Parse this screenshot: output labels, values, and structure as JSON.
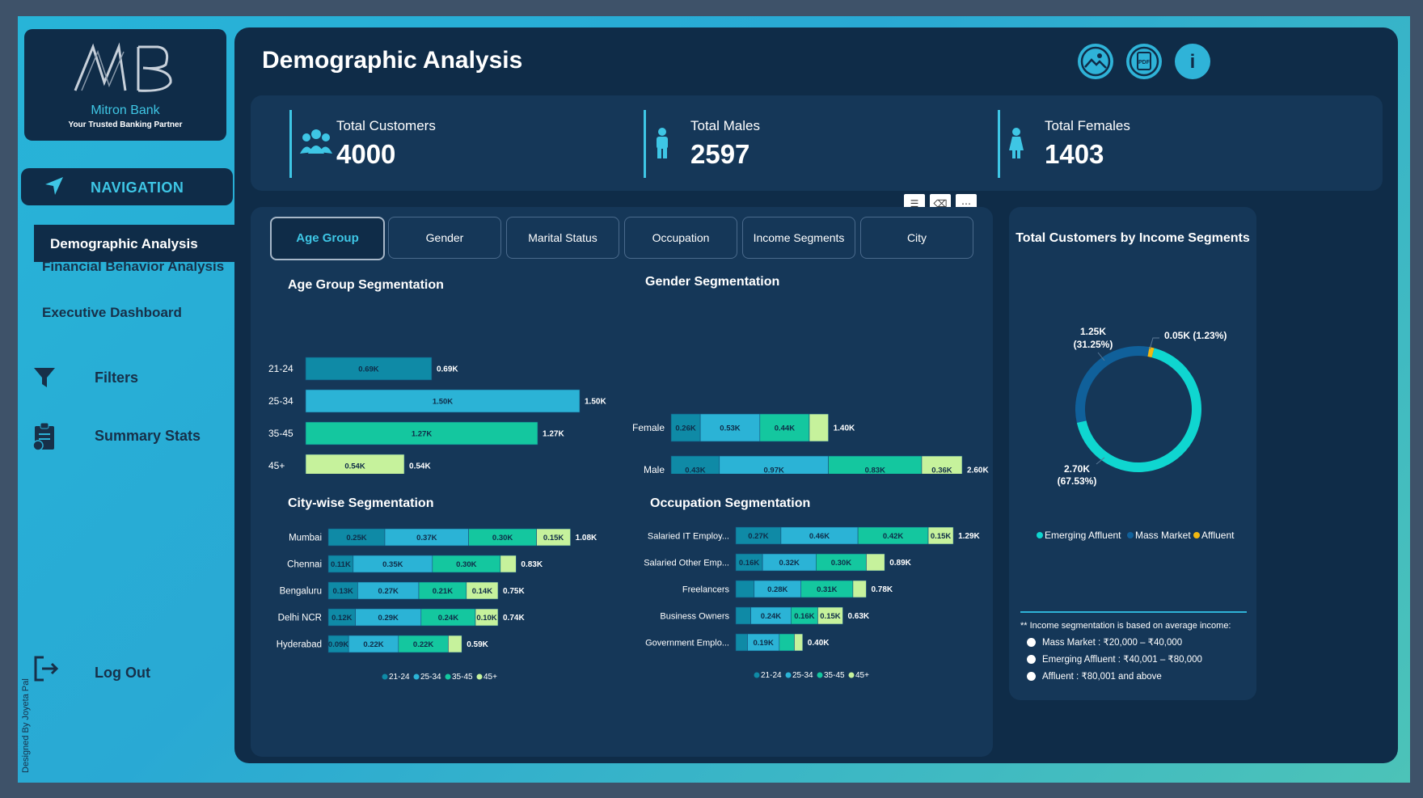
{
  "sidebar": {
    "bank_name": "Mitron Bank",
    "tagline": "Your Trusted Banking Partner",
    "nav_header": "NAVIGATION",
    "nav_items": [
      {
        "label": "Demographic Analysis",
        "active": true
      },
      {
        "label": "Financial Behavior Analysis"
      },
      {
        "label": "Executive Dashboard"
      }
    ],
    "filters_label": "Filters",
    "summary_label": "Summary Stats",
    "logout_label": "Log Out",
    "designed_by": "Designed By Joyeta Pal"
  },
  "header": {
    "title": "Demographic Analysis",
    "buttons": [
      {
        "icon": "image-icon"
      },
      {
        "icon": "pdf-icon",
        "text": "PDF"
      },
      {
        "icon": "info-icon",
        "text": "i"
      }
    ]
  },
  "kpis": [
    {
      "label": "Total Customers",
      "value": "4000",
      "icon": "people-icon"
    },
    {
      "label": "Total Males",
      "value": "2597",
      "icon": "male-icon"
    },
    {
      "label": "Total Females",
      "value": "1403",
      "icon": "female-icon"
    }
  ],
  "tabs": [
    "Age Group",
    "Gender",
    "Marital Status",
    "Occupation",
    "Income Segments",
    "City"
  ],
  "active_tab": "Age Group",
  "legend_labels": [
    "21-24",
    "25-34",
    "35-45",
    "45+"
  ],
  "colors": {
    "series": [
      "#0f8aa6",
      "#2bb3d6",
      "#14c79f",
      "#c6f29c"
    ],
    "income": {
      "Emerging Affluent": "#0fd6d0",
      "Mass Market": "#10609a",
      "Affluent": "#f1b811"
    },
    "accent": "#3ec6e5"
  },
  "chart_data": [
    {
      "type": "bar",
      "title": "Age Group Segmentation",
      "orientation": "horizontal",
      "categories": [
        "21-24",
        "25-34",
        "35-45",
        "45+"
      ],
      "values": [
        0.69,
        1.5,
        1.27,
        0.54
      ],
      "labels": [
        "0.69K",
        "1.50K",
        "1.27K",
        "0.54K"
      ],
      "totals": [
        "0.69K",
        "1.50K",
        "1.27K",
        "0.54K"
      ]
    },
    {
      "type": "bar",
      "title": "Gender Segmentation",
      "orientation": "horizontal",
      "stacked": true,
      "categories": [
        "Female",
        "Male"
      ],
      "series": [
        {
          "name": "21-24",
          "values": [
            0.26,
            0.43
          ],
          "labels": [
            "0.26K",
            "0.43K"
          ]
        },
        {
          "name": "25-34",
          "values": [
            0.53,
            0.97
          ],
          "labels": [
            "0.53K",
            "0.97K"
          ]
        },
        {
          "name": "35-45",
          "values": [
            0.44,
            0.83
          ],
          "labels": [
            "0.44K",
            "0.83K"
          ]
        },
        {
          "name": "45+",
          "values": [
            0.17,
            0.36
          ],
          "labels": [
            "",
            "0.36K"
          ]
        }
      ],
      "totals": [
        "1.40K",
        "2.60K"
      ]
    },
    {
      "type": "bar",
      "title": "City-wise Segmentation",
      "orientation": "horizontal",
      "stacked": true,
      "categories": [
        "Mumbai",
        "Chennai",
        "Bengaluru",
        "Delhi NCR",
        "Hyderabad"
      ],
      "series": [
        {
          "name": "21-24",
          "values": [
            0.25,
            0.11,
            0.13,
            0.12,
            0.09
          ],
          "labels": [
            "0.25K",
            "0.11K",
            "0.13K",
            "0.12K",
            "0.09K"
          ]
        },
        {
          "name": "25-34",
          "values": [
            0.37,
            0.35,
            0.27,
            0.29,
            0.22
          ],
          "labels": [
            "0.37K",
            "0.35K",
            "0.27K",
            "0.29K",
            "0.22K"
          ]
        },
        {
          "name": "35-45",
          "values": [
            0.3,
            0.3,
            0.21,
            0.24,
            0.22
          ],
          "labels": [
            "0.30K",
            "0.30K",
            "0.21K",
            "0.24K",
            "0.22K"
          ]
        },
        {
          "name": "45+",
          "values": [
            0.15,
            0.07,
            0.14,
            0.1,
            0.06
          ],
          "labels": [
            "0.15K",
            "",
            "0.14K",
            "0.10K",
            ""
          ]
        }
      ],
      "totals": [
        "1.08K",
        "0.83K",
        "0.75K",
        "0.74K",
        "0.59K"
      ]
    },
    {
      "type": "bar",
      "title": "Occupation Segmentation",
      "orientation": "horizontal",
      "stacked": true,
      "categories": [
        "Salaried IT Employ...",
        "Salaried Other Emp...",
        "Freelancers",
        "Business Owners",
        "Government Emplo..."
      ],
      "series": [
        {
          "name": "21-24",
          "values": [
            0.27,
            0.16,
            0.11,
            0.09,
            0.07
          ],
          "labels": [
            "0.27K",
            "0.16K",
            "",
            "",
            ""
          ]
        },
        {
          "name": "25-34",
          "values": [
            0.46,
            0.32,
            0.28,
            0.24,
            0.19
          ],
          "labels": [
            "0.46K",
            "0.32K",
            "0.28K",
            "0.24K",
            "0.19K"
          ]
        },
        {
          "name": "35-45",
          "values": [
            0.42,
            0.3,
            0.31,
            0.16,
            0.09
          ],
          "labels": [
            "0.42K",
            "0.30K",
            "0.31K",
            "0.16K",
            ""
          ]
        },
        {
          "name": "45+",
          "values": [
            0.15,
            0.11,
            0.08,
            0.15,
            0.05
          ],
          "labels": [
            "0.15K",
            "",
            "",
            "0.15K",
            ""
          ]
        }
      ],
      "totals": [
        "1.29K",
        "0.89K",
        "0.78K",
        "0.63K",
        "0.40K"
      ]
    },
    {
      "type": "pie",
      "donut": true,
      "title": "Total Customers by Income Segments",
      "categories": [
        "Emerging Affluent",
        "Mass Market",
        "Affluent"
      ],
      "values": [
        2.7,
        1.25,
        0.05
      ],
      "percentages": [
        67.53,
        31.25,
        1.23
      ],
      "labels": [
        {
          "value": "2.70K",
          "pct": "(67.53%)"
        },
        {
          "value": "1.25K",
          "pct": "(31.25%)"
        },
        {
          "value": "0.05K (1.23%)",
          "pct": ""
        }
      ],
      "legend": "bottom"
    }
  ],
  "income_note": {
    "heading": "** Income segmentation is based on average income:",
    "lines": [
      "Mass Market : ₹20,000 – ₹40,000",
      "Emerging Affluent : ₹40,001 – ₹80,000",
      "Affluent : ₹80,001 and above"
    ]
  }
}
